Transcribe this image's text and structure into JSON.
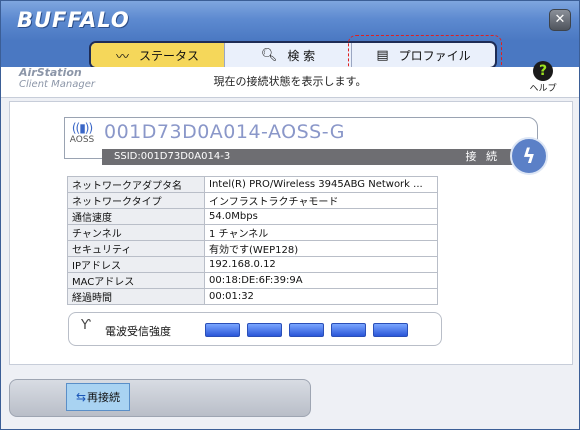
{
  "app": {
    "brand": "BUFFALO",
    "close_glyph": "✕"
  },
  "tabs": [
    {
      "label": "ステータス",
      "icon": "signal-wave-icon",
      "active": true
    },
    {
      "label": "検 索",
      "icon": "magnifier-icon",
      "active": false
    },
    {
      "label": "プロファイル",
      "icon": "profile-icon",
      "active": false
    }
  ],
  "header": {
    "logo_line1": "AirStation",
    "logo_line2": "Client Manager",
    "description": "現在の接続状態を表示します。",
    "help_label": "ヘルプ",
    "help_glyph": "?"
  },
  "connection": {
    "aoss_label": "AOSS",
    "ap_name": "001D73D0A014-AOSS-G",
    "ssid": "SSID:001D73D0A014-3",
    "status": "接 続"
  },
  "info_rows": [
    {
      "key": "ネットワークアダプタ名",
      "value": "Intel(R) PRO/Wireless 3945ABG Network ..."
    },
    {
      "key": "ネットワークタイプ",
      "value": "インフラストラクチャモード"
    },
    {
      "key": "通信速度",
      "value": "54.0Mbps"
    },
    {
      "key": "チャンネル",
      "value": "1 チャンネル"
    },
    {
      "key": "セキュリティ",
      "value": "有効です(WEP128)"
    },
    {
      "key": "IPアドレス",
      "value": "192.168.0.12"
    },
    {
      "key": "MACアドレス",
      "value": "00:18:DE:6F:39:9A"
    },
    {
      "key": "経過時間",
      "value": "00:01:32"
    }
  ],
  "signal": {
    "label": "電波受信強度",
    "level": 5,
    "max": 5
  },
  "footer": {
    "reconnect_label": "再接続"
  },
  "colors": {
    "accent": "#4a78c2",
    "active_tab": "#f5d75a",
    "signal_bar": "#2a56d8"
  }
}
